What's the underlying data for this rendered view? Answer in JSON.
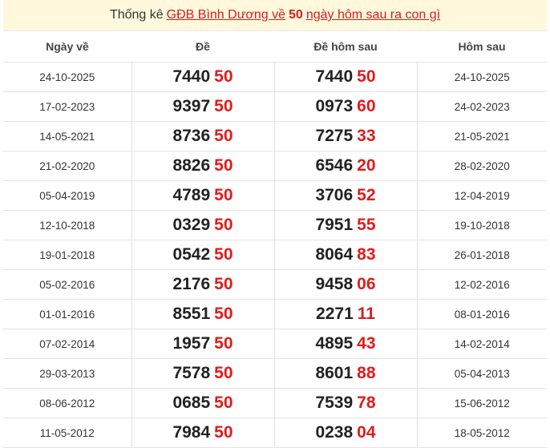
{
  "title": {
    "prefix": "Thống kê",
    "link": "GĐB Bình Dương về",
    "number": "50",
    "suffix": "ngày hôm sau ra con gì"
  },
  "headers": [
    "Ngày về",
    "Đề",
    "Đề hôm sau",
    "Hôm sau"
  ],
  "rows": [
    {
      "date": "24-10-2025",
      "de_head": "7440",
      "de_tail": "50",
      "next_head": "7440",
      "next_tail": "50",
      "next_date": "24-10-2025"
    },
    {
      "date": "17-02-2023",
      "de_head": "9397",
      "de_tail": "50",
      "next_head": "0973",
      "next_tail": "60",
      "next_date": "24-02-2023"
    },
    {
      "date": "14-05-2021",
      "de_head": "8736",
      "de_tail": "50",
      "next_head": "7275",
      "next_tail": "33",
      "next_date": "21-05-2021"
    },
    {
      "date": "21-02-2020",
      "de_head": "8826",
      "de_tail": "50",
      "next_head": "6546",
      "next_tail": "20",
      "next_date": "28-02-2020"
    },
    {
      "date": "05-04-2019",
      "de_head": "4789",
      "de_tail": "50",
      "next_head": "3706",
      "next_tail": "52",
      "next_date": "12-04-2019"
    },
    {
      "date": "12-10-2018",
      "de_head": "0329",
      "de_tail": "50",
      "next_head": "7951",
      "next_tail": "55",
      "next_date": "19-10-2018"
    },
    {
      "date": "19-01-2018",
      "de_head": "0542",
      "de_tail": "50",
      "next_head": "8064",
      "next_tail": "83",
      "next_date": "26-01-2018"
    },
    {
      "date": "05-02-2016",
      "de_head": "2176",
      "de_tail": "50",
      "next_head": "9458",
      "next_tail": "06",
      "next_date": "12-02-2016"
    },
    {
      "date": "01-01-2016",
      "de_head": "8551",
      "de_tail": "50",
      "next_head": "2271",
      "next_tail": "11",
      "next_date": "08-01-2016"
    },
    {
      "date": "07-02-2014",
      "de_head": "1957",
      "de_tail": "50",
      "next_head": "4895",
      "next_tail": "43",
      "next_date": "14-02-2014"
    },
    {
      "date": "29-03-2013",
      "de_head": "7578",
      "de_tail": "50",
      "next_head": "8601",
      "next_tail": "88",
      "next_date": "05-04-2013"
    },
    {
      "date": "08-06-2012",
      "de_head": "0685",
      "de_tail": "50",
      "next_head": "7539",
      "next_tail": "78",
      "next_date": "15-06-2012"
    },
    {
      "date": "11-05-2012",
      "de_head": "7984",
      "de_tail": "50",
      "next_head": "0238",
      "next_tail": "04",
      "next_date": "18-05-2012"
    }
  ],
  "colors": {
    "accent_red": "#e21b1b",
    "title_bg": "#fff8dc",
    "border": "#e3e3e3"
  }
}
